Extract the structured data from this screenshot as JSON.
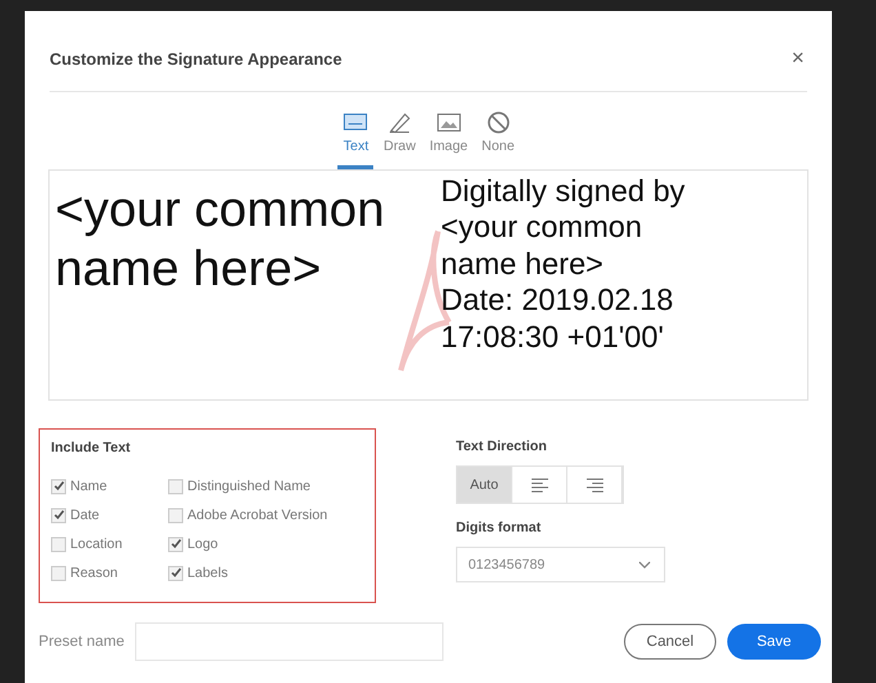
{
  "window": {
    "title": "Customize the Signature Appearance",
    "close": "×"
  },
  "tabs": [
    {
      "kind": "text",
      "label": "Text",
      "selected": true
    },
    {
      "kind": "draw",
      "label": "Draw",
      "selected": false
    },
    {
      "kind": "image",
      "label": "Image",
      "selected": false
    },
    {
      "kind": "none",
      "label": "None",
      "selected": false
    }
  ],
  "preview": {
    "name": "<your common name here>",
    "details": [
      "Digitally signed by",
      "<your common",
      "name here>",
      "Date: 2019.02.18",
      "17:08:30 +01'00'"
    ]
  },
  "include_text": {
    "title": "Include Text",
    "columns": [
      [
        {
          "label": "Name",
          "checked": true
        },
        {
          "label": "Date",
          "checked": true
        },
        {
          "label": "Location",
          "checked": false
        },
        {
          "label": "Reason",
          "checked": false
        }
      ],
      [
        {
          "label": "Distinguished Name",
          "checked": false
        },
        {
          "label": "Adobe Acrobat Version",
          "checked": false
        },
        {
          "label": "Logo",
          "checked": true
        },
        {
          "label": "Labels",
          "checked": true
        }
      ]
    ]
  },
  "text_direction": {
    "title": "Text Direction",
    "options": [
      {
        "kind": "text",
        "label": "Auto",
        "selected": true
      },
      {
        "kind": "align-left",
        "selected": false
      },
      {
        "kind": "align-right",
        "selected": false
      }
    ]
  },
  "digits_format": {
    "title": "Digits format",
    "value": "0123456789"
  },
  "preset": {
    "label": "Preset name"
  },
  "buttons": [
    {
      "kind": "secondary",
      "label": "Cancel"
    },
    {
      "kind": "primary",
      "label": "Save"
    }
  ]
}
